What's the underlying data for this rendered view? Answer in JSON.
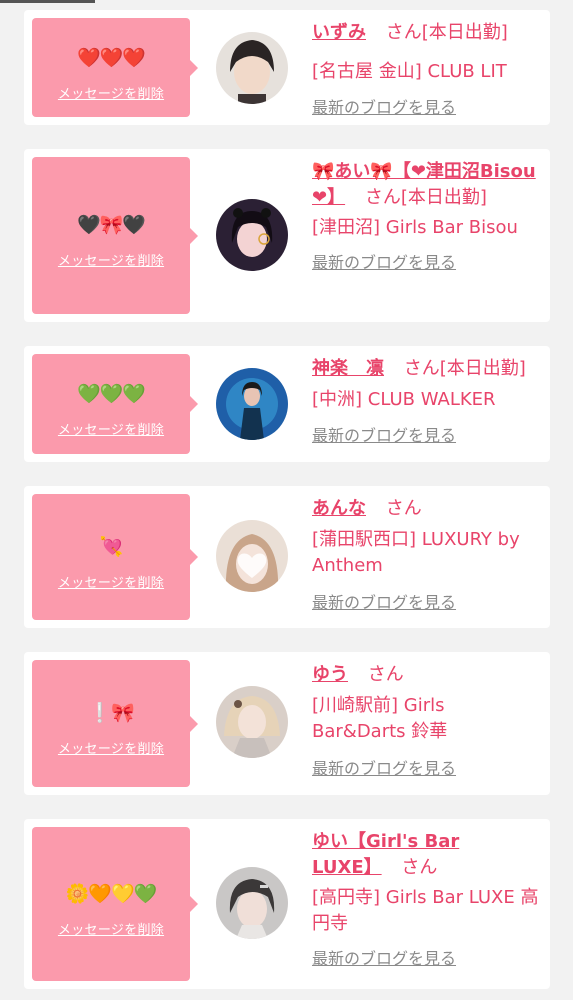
{
  "colors": {
    "accent": "#e8446a",
    "bubble": "#fb9aac",
    "muted": "#8a8a8a",
    "background": "#f2f2f2",
    "card": "#ffffff"
  },
  "cards": [
    {
      "emoji": "❤️❤️❤️",
      "delete_label": "メッセージを削除",
      "name": "いずみ",
      "honorific": "さん",
      "status": "[本日出勤]",
      "shop": "[名古屋 金山] CLUB LIT",
      "blog_label": "最新のブログを見る"
    },
    {
      "emoji": "🖤🎀🖤",
      "delete_label": "メッセージを削除",
      "name": "🎀あい🎀【❤津田沼Bisou❤】",
      "honorific": "さん",
      "status": "[本日出勤]",
      "shop": "[津田沼] Girls Bar Bisou",
      "blog_label": "最新のブログを見る"
    },
    {
      "emoji": "💚💚💚",
      "delete_label": "メッセージを削除",
      "name": "神楽　凛",
      "honorific": "さん",
      "status": "[本日出勤]",
      "shop": "[中洲] CLUB WALKER",
      "blog_label": "最新のブログを見る"
    },
    {
      "emoji": "💘",
      "delete_label": "メッセージを削除",
      "name": "あんな",
      "honorific": "さん",
      "status": "",
      "shop": "[蒲田駅西口] LUXURY by Anthem",
      "blog_label": "最新のブログを見る"
    },
    {
      "emoji": "❕🎀",
      "delete_label": "メッセージを削除",
      "name": "ゆう",
      "honorific": "さん",
      "status": "",
      "shop": "[川崎駅前] Girls Bar&Darts 鈴華",
      "blog_label": "最新のブログを見る"
    },
    {
      "emoji": "🌼🧡💛💚",
      "delete_label": "メッセージを削除",
      "name": "ゆい【Girl's Bar LUXE】",
      "honorific": "さん",
      "status": "",
      "shop": "[高円寺] Girls Bar LUXE 高円寺",
      "blog_label": "最新のブログを見る"
    }
  ]
}
